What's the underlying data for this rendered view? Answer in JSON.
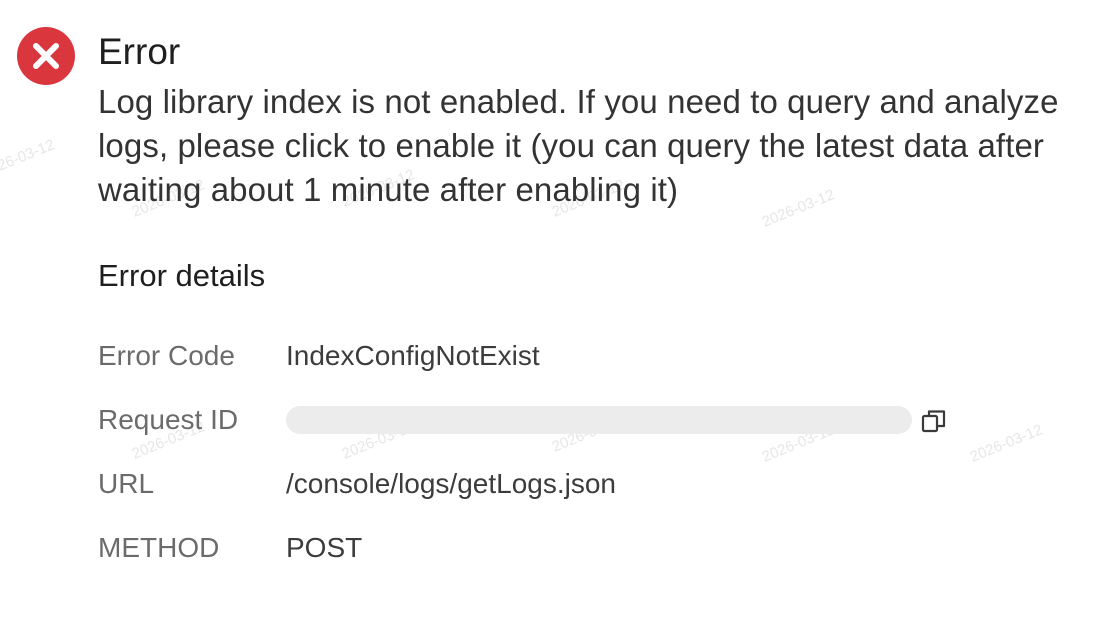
{
  "error": {
    "title": "Error",
    "message": "Log library index is not enabled. If you need to query and analyze logs, please click to enable it (you can query the latest data after waiting about 1 minute after enabling it)"
  },
  "details": {
    "heading": "Error details",
    "rows": [
      {
        "label": "Error Code",
        "value": "IndexConfigNotExist"
      },
      {
        "label": "Request ID",
        "value": ""
      },
      {
        "label": "URL",
        "value": "/console/logs/getLogs.json"
      },
      {
        "label": "METHOD",
        "value": "POST"
      }
    ]
  },
  "watermark": {
    "text": "2026-03-12"
  },
  "colors": {
    "error_icon": "#d9363e",
    "redaction": "#ececec"
  },
  "icons": {
    "error": "close-circle-icon",
    "copy": "copy-icon"
  }
}
